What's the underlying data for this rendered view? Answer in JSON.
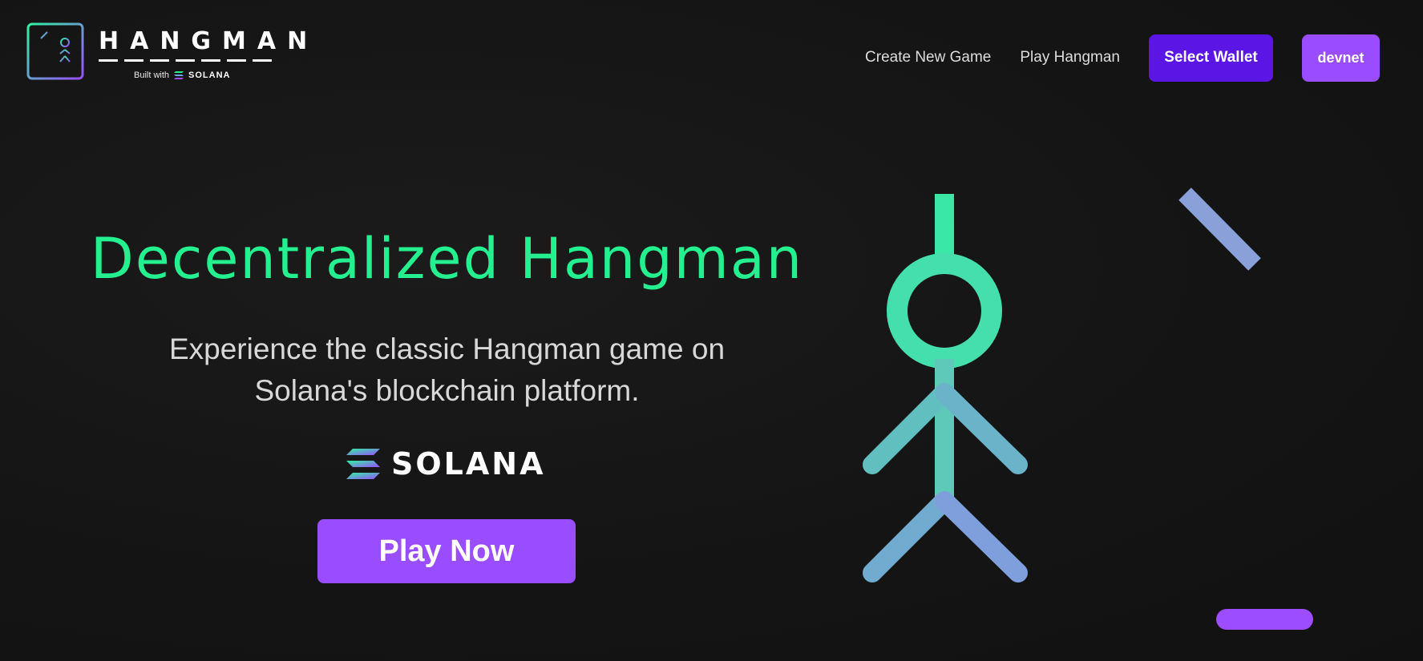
{
  "logo": {
    "wordmark": "HANGMAN",
    "built_with": "Built with",
    "built_with_brand": "SOLANA"
  },
  "nav": {
    "create_label": "Create New Game",
    "play_label": "Play Hangman",
    "wallet_label": "Select Wallet",
    "network_label": "devnet"
  },
  "hero": {
    "title": "Decentralized Hangman",
    "subtitle_line1": "Experience the classic Hangman game on",
    "subtitle_line2": "Solana's blockchain platform.",
    "brand": "SOLANA",
    "cta_label": "Play Now"
  },
  "colors": {
    "background": "#141414",
    "title_green": "#25f08f",
    "wallet_purple": "#5b16e6",
    "accent_purple": "#9a4cff",
    "gradient_start": "#2ff3a0",
    "gradient_end": "#9b4dff"
  },
  "icons": {
    "logo": "hangman-logo-icon",
    "solana": "solana-logo-icon",
    "illustration": "gallows-stickman-illustration"
  }
}
